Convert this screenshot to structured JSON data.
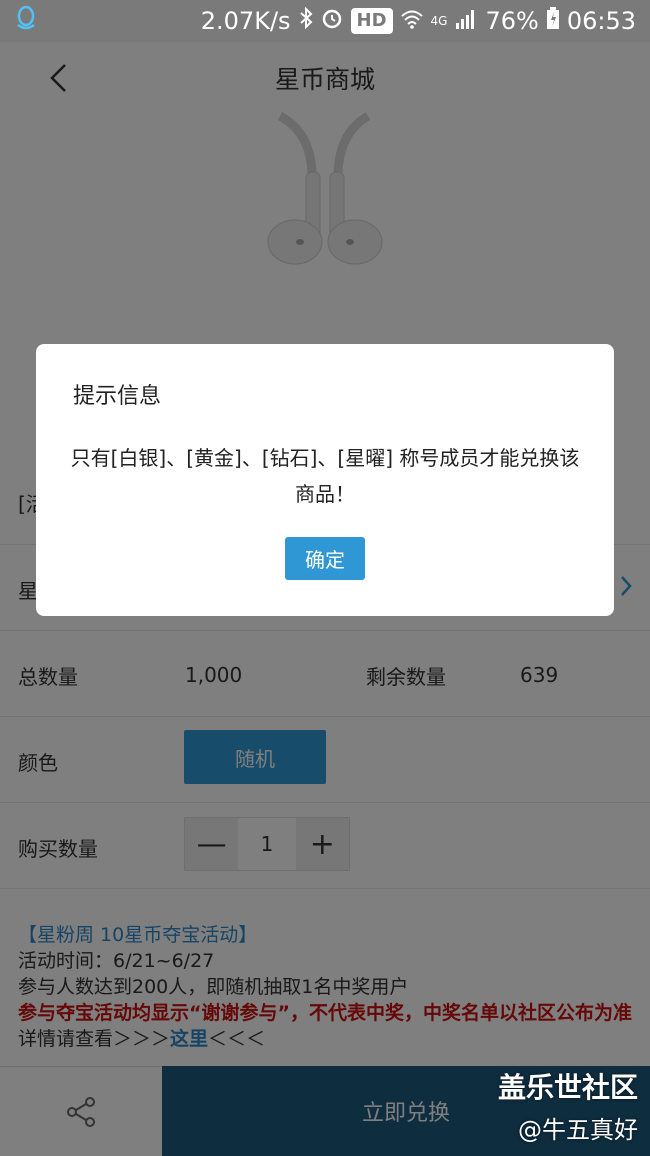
{
  "status_bar": {
    "network_speed": "2.07K/s",
    "hd": "HD",
    "network_type": "4G",
    "battery": "76%",
    "time": "06:53"
  },
  "header": {
    "title": "星币商城"
  },
  "product": {
    "promo_title_partial": "[活"
  },
  "rows": {
    "star_label_partial": "星",
    "total_label": "总数量",
    "total_value": "1,000",
    "remaining_label": "剩余数量",
    "remaining_value": "639",
    "color_label": "颜色",
    "color_option": "随机",
    "qty_label": "购买数量",
    "qty_minus": "—",
    "qty_value": "1",
    "qty_plus": "+"
  },
  "promo": {
    "title": "【星粉周 10星币夺宝活动】",
    "time": "活动时间：6/21~6/27",
    "rule": "参与人数达到200人，即随机抽取1名中奖用户",
    "notice": "参与夺宝活动均显示“谢谢参与”，不代表中奖，中奖名单以社区公布为准",
    "more_prefix": "详情请查看＞＞＞",
    "more_link": "这里",
    "more_suffix": "＜＜＜"
  },
  "bottom_bar": {
    "exchange_label": "立即兑换"
  },
  "dialog": {
    "title": "提示信息",
    "message": "只有[白银]、[黄金]、[钻石]、[星曜] 称号成员才能兑换该商品！",
    "ok_label": "确定"
  },
  "watermark": {
    "line1": "盖乐世社区",
    "line2": "@牛五真好"
  },
  "colors": {
    "accent": "#2f98d4",
    "exchange_bg": "#1d5b7e",
    "promo_red": "#cc1111",
    "promo_blue": "#2f88c8"
  }
}
